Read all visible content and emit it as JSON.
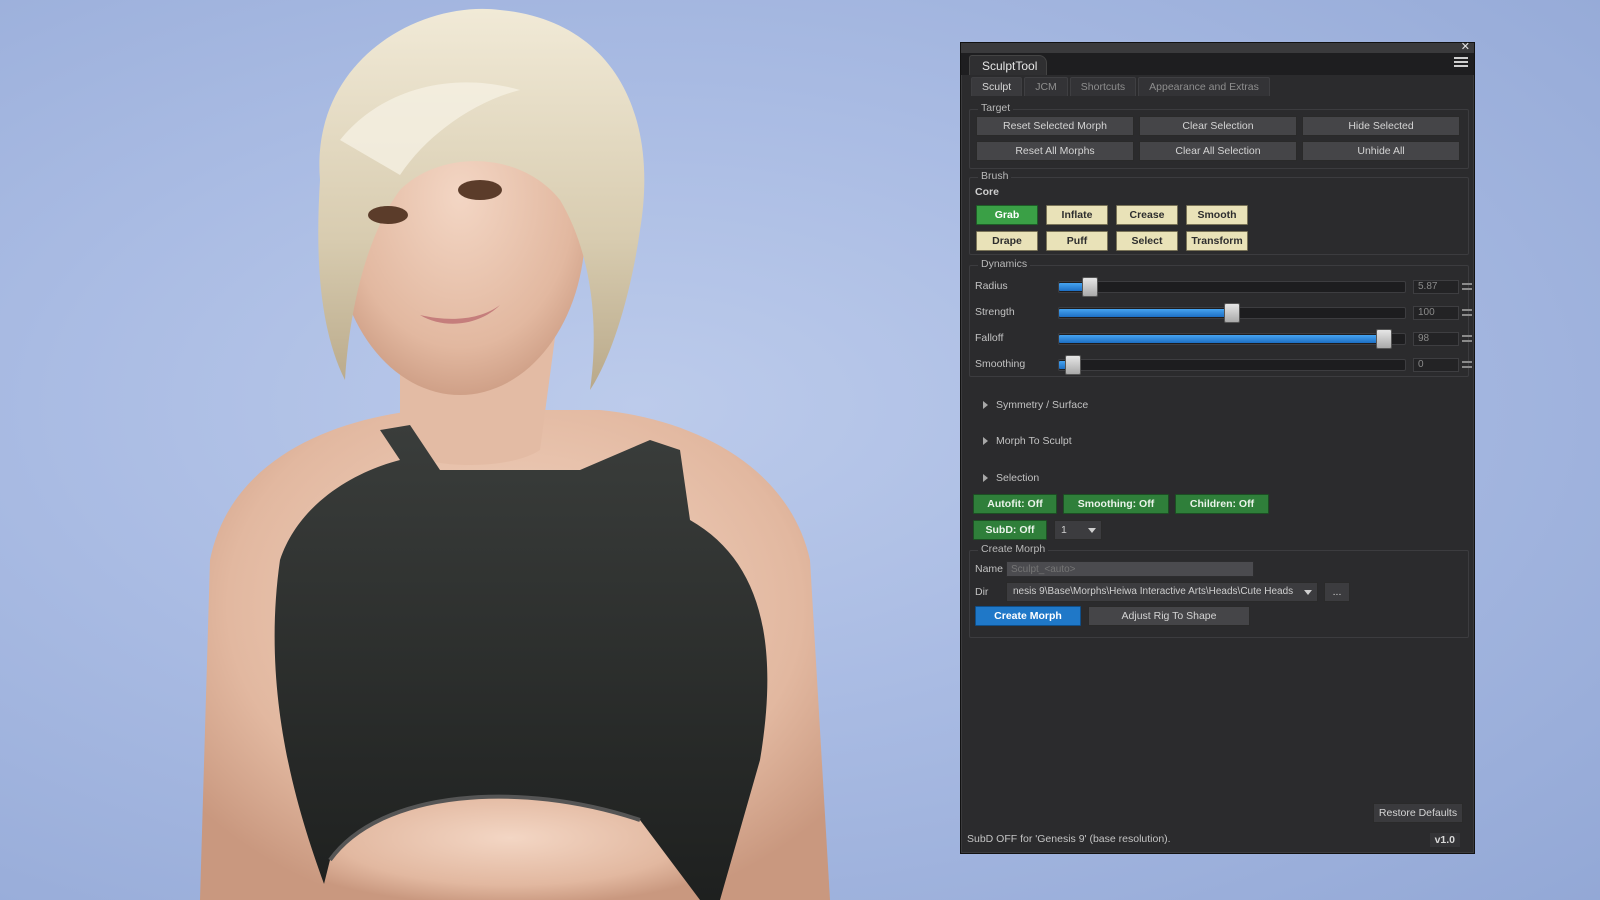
{
  "window": {
    "title": "SculptTool",
    "close_glyph": "✕"
  },
  "tabs": [
    {
      "label": "Sculpt",
      "active": true
    },
    {
      "label": "JCM",
      "active": false
    },
    {
      "label": "Shortcuts",
      "active": false
    },
    {
      "label": "Appearance and Extras",
      "active": false
    }
  ],
  "target": {
    "title": "Target",
    "reset_selected_morph": "Reset Selected Morph",
    "clear_selection": "Clear Selection",
    "hide_selected": "Hide Selected",
    "reset_all_morphs": "Reset All Morphs",
    "clear_all_selection": "Clear All Selection",
    "unhide_all": "Unhide All"
  },
  "brush": {
    "title": "Brush",
    "core_label": "Core",
    "buttons": {
      "grab": "Grab",
      "inflate": "Inflate",
      "crease": "Crease",
      "smooth": "Smooth",
      "drape": "Drape",
      "puff": "Puff",
      "select": "Select",
      "transform": "Transform"
    },
    "active": "Grab"
  },
  "dynamics": {
    "title": "Dynamics",
    "radius": {
      "label": "Radius",
      "value": "5.87",
      "fraction": 0.09
    },
    "strength": {
      "label": "Strength",
      "value": "100",
      "fraction": 0.5
    },
    "falloff": {
      "label": "Falloff",
      "value": "98",
      "fraction": 0.94
    },
    "smoothing": {
      "label": "Smoothing",
      "value": "0",
      "fraction": 0.04
    }
  },
  "sections": {
    "symmetry": "Symmetry / Surface",
    "morph_to_sculpt": "Morph To Sculpt",
    "selection": "Selection"
  },
  "toggles": {
    "autofit": "Autofit: Off",
    "smoothing": "Smoothing: Off",
    "children": "Children: Off",
    "subd": "SubD: Off",
    "subd_level": "1"
  },
  "create_morph": {
    "title": "Create Morph",
    "name_label": "Name",
    "name_placeholder": "Sculpt_<auto>",
    "dir_label": "Dir",
    "dir_value": "nesis 9\\Base\\Morphs\\Heiwa Interactive Arts\\Heads\\Cute Heads",
    "browse_label": "...",
    "create_button": "Create Morph",
    "adjust_rig_button": "Adjust Rig To Shape"
  },
  "footer": {
    "restore_defaults": "Restore Defaults",
    "status": "SubD OFF for 'Genesis 9' (base resolution).",
    "version": "v1.0"
  },
  "colors": {
    "accent_blue": "#1f78c8",
    "active_green": "#3aa046",
    "toggle_green": "#2f7f3a",
    "brush_cream": "#e9e2b8",
    "panel_bg": "#2b2b2d"
  }
}
